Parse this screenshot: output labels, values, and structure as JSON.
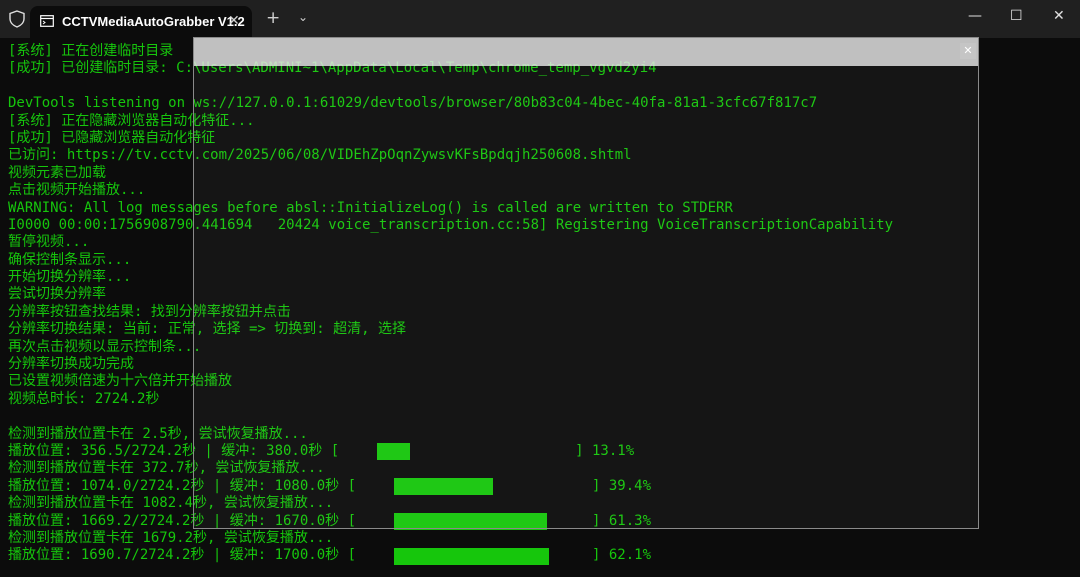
{
  "window": {
    "tab_title": "CCTVMediaAutoGrabber V1.2",
    "tab_close": "✕",
    "new_tab": "+",
    "dropdown": "⌄",
    "minimize": "—",
    "maximize": "☐",
    "close": "✕"
  },
  "overlay": {
    "close": "✕"
  },
  "colors": {
    "terminal_text": "#16c60c",
    "background": "#0c0c0c"
  },
  "log": [
    "[系统] 正在创建临时目录",
    "[成功] 已创建临时目录: C:\\Users\\ADMINI~1\\AppData\\Local\\Temp\\chrome_temp_vgvd2yi4",
    "",
    "DevTools listening on ws://127.0.0.1:61029/devtools/browser/80b83c04-4bec-40fa-81a1-3cfc67f817c7",
    "[系统] 正在隐藏浏览器自动化特征...",
    "[成功] 已隐藏浏览器自动化特征",
    "已访问: https://tv.cctv.com/2025/06/08/VIDEhZpOqnZywsvKFsBpdqjh250608.shtml",
    "视频元素已加载",
    "点击视频开始播放...",
    "WARNING: All log messages before absl::InitializeLog() is called are written to STDERR",
    "I0000 00:00:1756908790.441694   20424 voice_transcription.cc:58] Registering VoiceTranscriptionCapability",
    "暂停视频...",
    "确保控制条显示...",
    "开始切换分辨率...",
    "尝试切换分辨率",
    "分辨率按钮查找结果: 找到分辨率按钮并点击",
    "分辨率切换结果: 当前: 正常, 选择 => 切换到: 超清, 选择",
    "再次点击视频以显示控制条...",
    "分辨率切换成功完成",
    "已设置视频倍速为十六倍并开始播放",
    "视频总时长: 2724.2秒",
    "",
    "检测到播放位置卡在 2.5秒, 尝试恢复播放...",
    "播放位置: 356.5/2724.2秒 | 缓冲: 380.0秒 [                            ] 13.1%",
    "检测到播放位置卡在 372.7秒, 尝试恢复播放...",
    "播放位置: 1074.0/2724.2秒 | 缓冲: 1080.0秒 [                            ] 39.4%",
    "检测到播放位置卡在 1082.4秒, 尝试恢复播放...",
    "播放位置: 1669.2/2724.2秒 | 缓冲: 1670.0秒 [                            ] 61.3%",
    "检测到播放位置卡在 1679.2秒, 尝试恢复播放...",
    "播放位置: 1690.7/2724.2秒 | 缓冲: 1700.0秒 [                            ] 62.1%"
  ],
  "progress": [
    {
      "line": 23,
      "percent": 13.1
    },
    {
      "line": 25,
      "percent": 39.4
    },
    {
      "line": 27,
      "percent": 61.3
    },
    {
      "line": 29,
      "percent": 62.1
    }
  ]
}
